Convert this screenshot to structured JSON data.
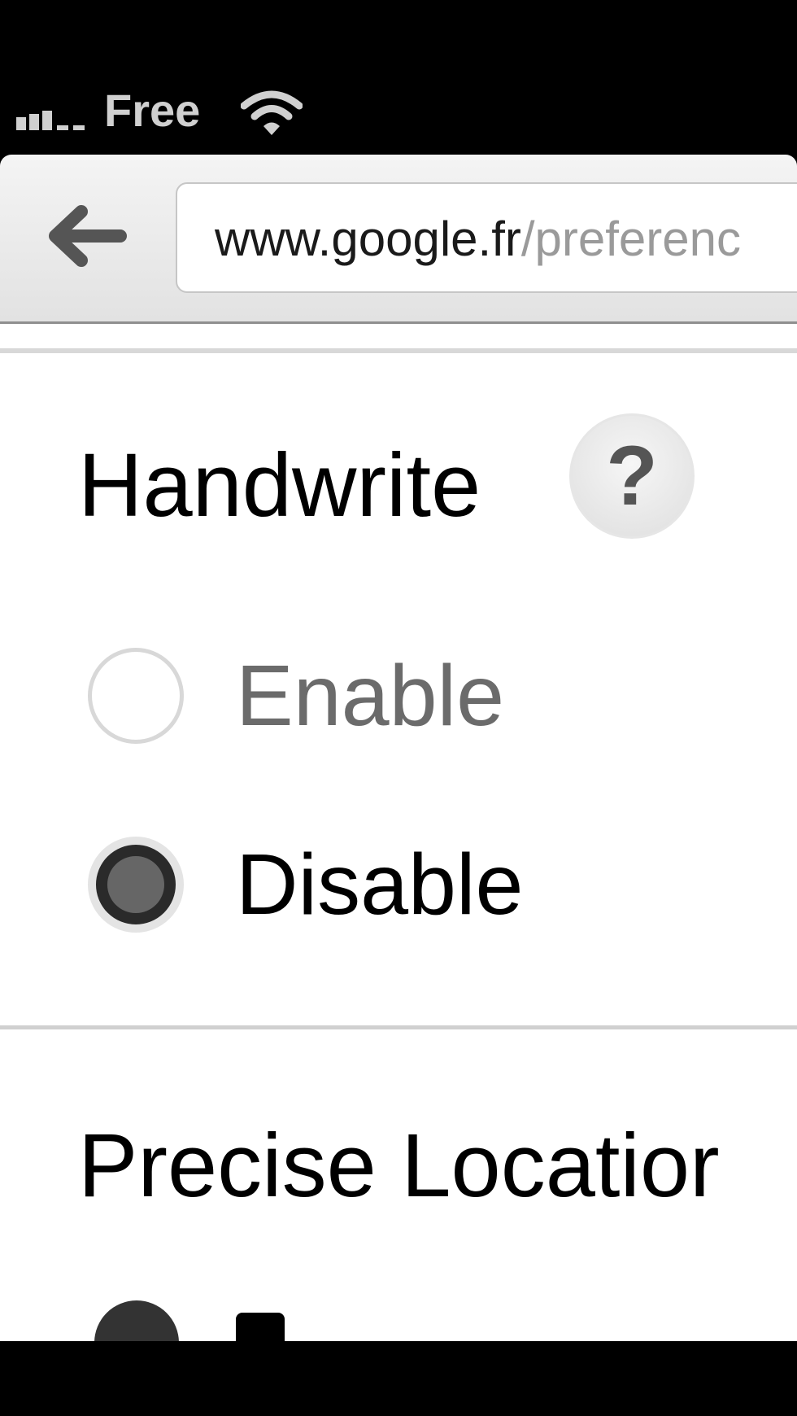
{
  "status_bar": {
    "carrier": "Free",
    "signal_icon": "signal-bars-icon",
    "wifi_icon": "wifi-icon"
  },
  "toolbar": {
    "back_icon": "back-arrow-icon",
    "url_domain": "www.google.fr",
    "url_path": "/preferenc"
  },
  "sections": {
    "handwrite": {
      "title": "Handwrite",
      "help_label": "?",
      "options": [
        {
          "label": "Enable",
          "selected": false
        },
        {
          "label": "Disable",
          "selected": true
        }
      ]
    },
    "precise_location": {
      "title": "Precise Locatior"
    }
  },
  "colors": {
    "page_bg": "#ffffff",
    "status_bg": "#000000",
    "toolbar_bg": "#ececec"
  }
}
